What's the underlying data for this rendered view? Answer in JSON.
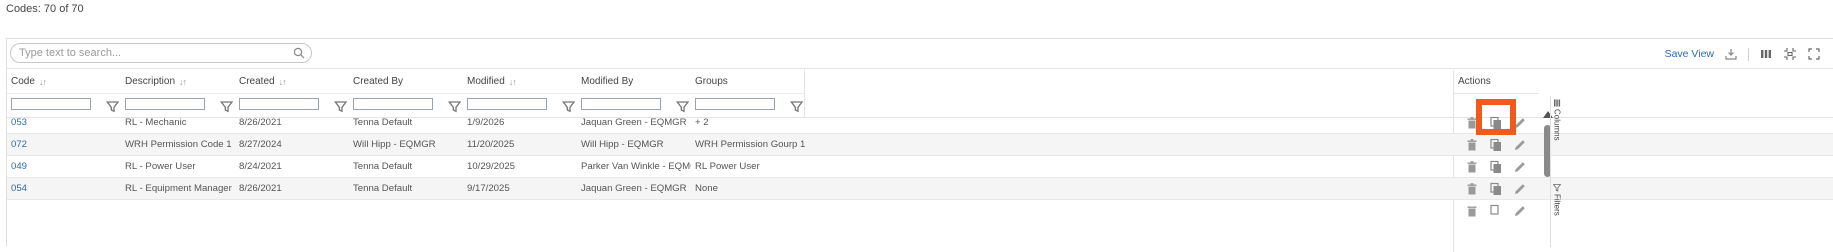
{
  "summary": {
    "label": "Codes: 70 of 70"
  },
  "search": {
    "placeholder": "Type text to search..."
  },
  "toolbar": {
    "save_view_label": "Save View",
    "icons": [
      "download-icon",
      "column-view-icon",
      "fit-icon",
      "fullscreen-icon"
    ]
  },
  "columns": [
    {
      "key": "code",
      "label": "Code",
      "sortable": true
    },
    {
      "key": "description",
      "label": "Description",
      "sortable": true
    },
    {
      "key": "created",
      "label": "Created",
      "sortable": true
    },
    {
      "key": "created_by",
      "label": "Created By",
      "sortable": false
    },
    {
      "key": "modified",
      "label": "Modified",
      "sortable": true
    },
    {
      "key": "modified_by",
      "label": "Modified By",
      "sortable": false
    },
    {
      "key": "groups",
      "label": "Groups",
      "sortable": false
    }
  ],
  "actions_header": "Actions",
  "rows": [
    {
      "code": "053",
      "description": "RL - Mechanic",
      "created": "8/26/2021",
      "created_by": "Tenna Default",
      "modified": "1/9/2026",
      "modified_by": "Jaquan Green - EQMGR",
      "groups": "+ 2"
    },
    {
      "code": "072",
      "description": "WRH Permission Code 1",
      "created": "8/27/2024",
      "created_by": "Will Hipp - EQMGR",
      "modified": "11/20/2025",
      "modified_by": "Will Hipp - EQMGR",
      "groups": "WRH Permission Gourp 1"
    },
    {
      "code": "049",
      "description": "RL - Power User",
      "created": "8/24/2021",
      "created_by": "Tenna Default",
      "modified": "10/29/2025",
      "modified_by": "Parker Van Winkle - EQMGR",
      "groups": "RL Power User"
    },
    {
      "code": "054",
      "description": "RL - Equipment Manager",
      "created": "8/26/2021",
      "created_by": "Tenna Default",
      "modified": "9/17/2025",
      "modified_by": "Jaquan Green - EQMGR",
      "groups": "None"
    }
  ],
  "row_actions": [
    "delete-icon",
    "copy-icon",
    "edit-icon"
  ],
  "side_panel": {
    "columns_label": "Columns",
    "filters_label": "Filters"
  }
}
